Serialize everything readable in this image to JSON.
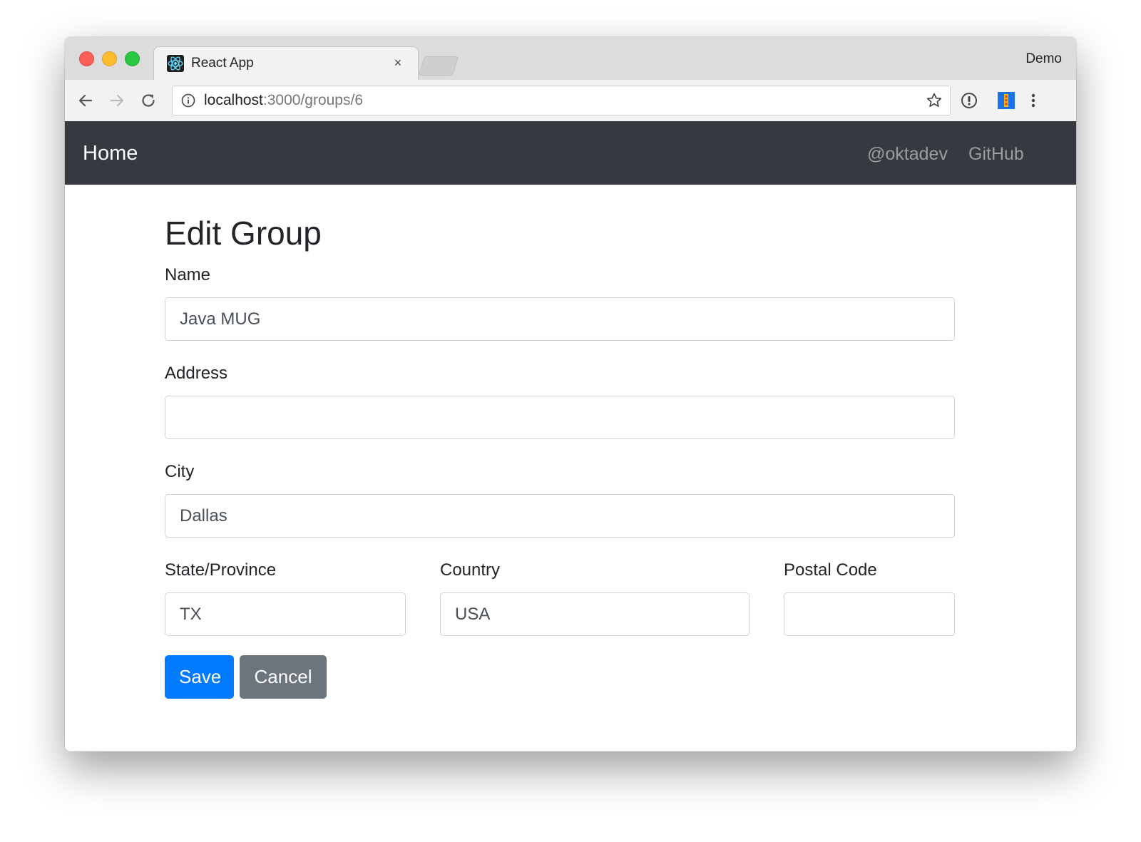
{
  "browser": {
    "tab_title": "React App",
    "tab_close_glyph": "×",
    "profile_name": "Demo",
    "url_host": "localhost",
    "url_path": ":3000/groups/6"
  },
  "navbar": {
    "brand": "Home",
    "links": [
      "@oktadev",
      "GitHub"
    ]
  },
  "form": {
    "title": "Edit Group",
    "name_label": "Name",
    "name_value": "Java MUG",
    "address_label": "Address",
    "address_value": "",
    "city_label": "City",
    "city_value": "Dallas",
    "state_label": "State/Province",
    "state_value": "TX",
    "country_label": "Country",
    "country_value": "USA",
    "postal_label": "Postal Code",
    "postal_value": "",
    "save_label": "Save",
    "cancel_label": "Cancel"
  },
  "colors": {
    "navbar_bg": "#343a40",
    "primary": "#007bff",
    "secondary": "#6c757d"
  },
  "icons": {
    "favicon": "react-atom-icon",
    "back": "arrow-left-icon",
    "forward": "arrow-right-icon",
    "reload": "reload-icon",
    "info": "info-icon",
    "bookmark": "star-icon",
    "password": "password-manager-icon",
    "extension": "extension-icon",
    "menu": "kebab-menu-icon"
  }
}
